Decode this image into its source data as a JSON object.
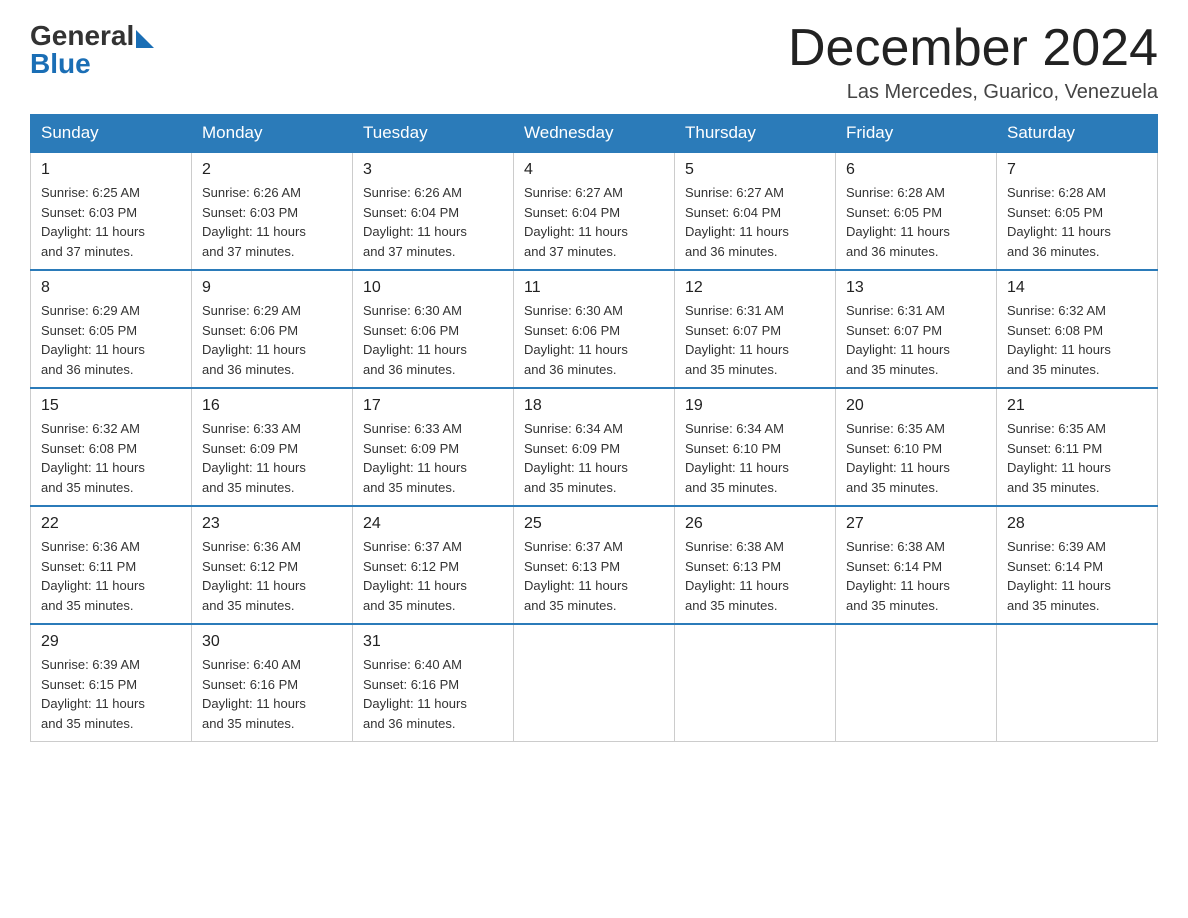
{
  "logo": {
    "general": "General",
    "blue": "Blue"
  },
  "header": {
    "title": "December 2024",
    "subtitle": "Las Mercedes, Guarico, Venezuela"
  },
  "weekdays": [
    "Sunday",
    "Monday",
    "Tuesday",
    "Wednesday",
    "Thursday",
    "Friday",
    "Saturday"
  ],
  "weeks": [
    [
      {
        "day": "1",
        "sunrise": "6:25 AM",
        "sunset": "6:03 PM",
        "daylight": "11 hours and 37 minutes."
      },
      {
        "day": "2",
        "sunrise": "6:26 AM",
        "sunset": "6:03 PM",
        "daylight": "11 hours and 37 minutes."
      },
      {
        "day": "3",
        "sunrise": "6:26 AM",
        "sunset": "6:04 PM",
        "daylight": "11 hours and 37 minutes."
      },
      {
        "day": "4",
        "sunrise": "6:27 AM",
        "sunset": "6:04 PM",
        "daylight": "11 hours and 37 minutes."
      },
      {
        "day": "5",
        "sunrise": "6:27 AM",
        "sunset": "6:04 PM",
        "daylight": "11 hours and 36 minutes."
      },
      {
        "day": "6",
        "sunrise": "6:28 AM",
        "sunset": "6:05 PM",
        "daylight": "11 hours and 36 minutes."
      },
      {
        "day": "7",
        "sunrise": "6:28 AM",
        "sunset": "6:05 PM",
        "daylight": "11 hours and 36 minutes."
      }
    ],
    [
      {
        "day": "8",
        "sunrise": "6:29 AM",
        "sunset": "6:05 PM",
        "daylight": "11 hours and 36 minutes."
      },
      {
        "day": "9",
        "sunrise": "6:29 AM",
        "sunset": "6:06 PM",
        "daylight": "11 hours and 36 minutes."
      },
      {
        "day": "10",
        "sunrise": "6:30 AM",
        "sunset": "6:06 PM",
        "daylight": "11 hours and 36 minutes."
      },
      {
        "day": "11",
        "sunrise": "6:30 AM",
        "sunset": "6:06 PM",
        "daylight": "11 hours and 36 minutes."
      },
      {
        "day": "12",
        "sunrise": "6:31 AM",
        "sunset": "6:07 PM",
        "daylight": "11 hours and 35 minutes."
      },
      {
        "day": "13",
        "sunrise": "6:31 AM",
        "sunset": "6:07 PM",
        "daylight": "11 hours and 35 minutes."
      },
      {
        "day": "14",
        "sunrise": "6:32 AM",
        "sunset": "6:08 PM",
        "daylight": "11 hours and 35 minutes."
      }
    ],
    [
      {
        "day": "15",
        "sunrise": "6:32 AM",
        "sunset": "6:08 PM",
        "daylight": "11 hours and 35 minutes."
      },
      {
        "day": "16",
        "sunrise": "6:33 AM",
        "sunset": "6:09 PM",
        "daylight": "11 hours and 35 minutes."
      },
      {
        "day": "17",
        "sunrise": "6:33 AM",
        "sunset": "6:09 PM",
        "daylight": "11 hours and 35 minutes."
      },
      {
        "day": "18",
        "sunrise": "6:34 AM",
        "sunset": "6:09 PM",
        "daylight": "11 hours and 35 minutes."
      },
      {
        "day": "19",
        "sunrise": "6:34 AM",
        "sunset": "6:10 PM",
        "daylight": "11 hours and 35 minutes."
      },
      {
        "day": "20",
        "sunrise": "6:35 AM",
        "sunset": "6:10 PM",
        "daylight": "11 hours and 35 minutes."
      },
      {
        "day": "21",
        "sunrise": "6:35 AM",
        "sunset": "6:11 PM",
        "daylight": "11 hours and 35 minutes."
      }
    ],
    [
      {
        "day": "22",
        "sunrise": "6:36 AM",
        "sunset": "6:11 PM",
        "daylight": "11 hours and 35 minutes."
      },
      {
        "day": "23",
        "sunrise": "6:36 AM",
        "sunset": "6:12 PM",
        "daylight": "11 hours and 35 minutes."
      },
      {
        "day": "24",
        "sunrise": "6:37 AM",
        "sunset": "6:12 PM",
        "daylight": "11 hours and 35 minutes."
      },
      {
        "day": "25",
        "sunrise": "6:37 AM",
        "sunset": "6:13 PM",
        "daylight": "11 hours and 35 minutes."
      },
      {
        "day": "26",
        "sunrise": "6:38 AM",
        "sunset": "6:13 PM",
        "daylight": "11 hours and 35 minutes."
      },
      {
        "day": "27",
        "sunrise": "6:38 AM",
        "sunset": "6:14 PM",
        "daylight": "11 hours and 35 minutes."
      },
      {
        "day": "28",
        "sunrise": "6:39 AM",
        "sunset": "6:14 PM",
        "daylight": "11 hours and 35 minutes."
      }
    ],
    [
      {
        "day": "29",
        "sunrise": "6:39 AM",
        "sunset": "6:15 PM",
        "daylight": "11 hours and 35 minutes."
      },
      {
        "day": "30",
        "sunrise": "6:40 AM",
        "sunset": "6:16 PM",
        "daylight": "11 hours and 35 minutes."
      },
      {
        "day": "31",
        "sunrise": "6:40 AM",
        "sunset": "6:16 PM",
        "daylight": "11 hours and 36 minutes."
      },
      null,
      null,
      null,
      null
    ]
  ],
  "labels": {
    "sunrise": "Sunrise:",
    "sunset": "Sunset:",
    "daylight": "Daylight:"
  }
}
